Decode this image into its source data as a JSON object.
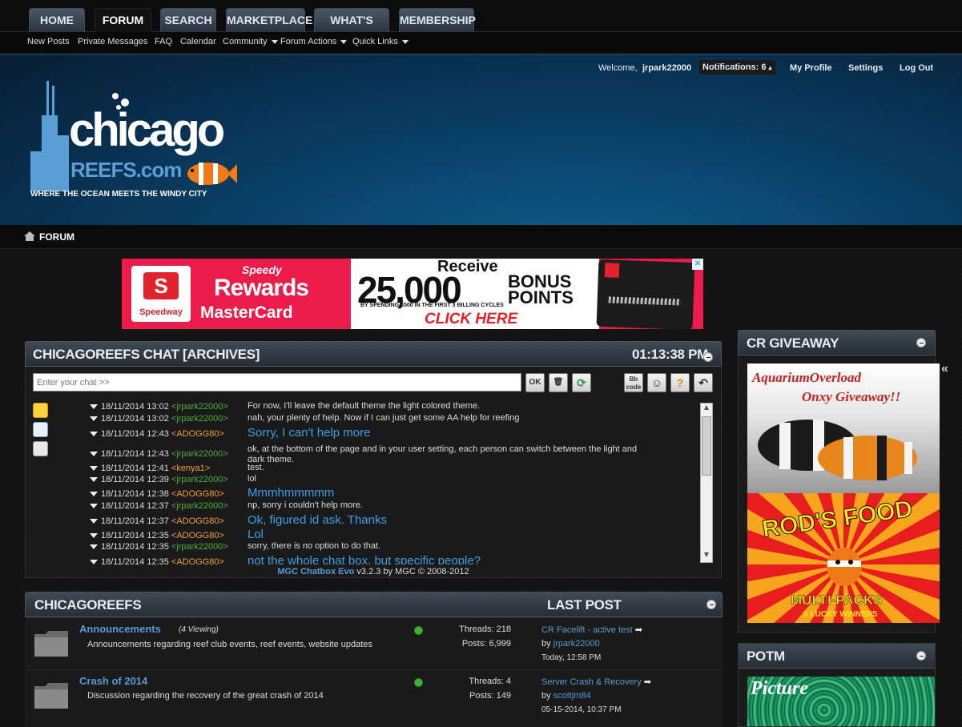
{
  "nav": {
    "tabs": [
      {
        "label": "HOME"
      },
      {
        "label": "FORUM"
      },
      {
        "label": "SEARCH"
      },
      {
        "label": "MARKETPLACE"
      },
      {
        "label": "WHAT'S NEW?"
      },
      {
        "label": "MEMBERSHIP"
      }
    ],
    "sublinks": [
      "New Posts",
      "Private Messages",
      "FAQ",
      "Calendar",
      "Community",
      "Forum Actions",
      "Quick Links"
    ]
  },
  "user": {
    "welcome": "Welcome,",
    "username": "jrpark22000",
    "notifications": "Notifications: 6",
    "profile": "My Profile",
    "settings": "Settings",
    "logout": "Log Out"
  },
  "logo": {
    "line1": "chicago",
    "line2": "REEFS.com",
    "tagline": "WHERE THE OCEAN MEETS THE WINDY CITY"
  },
  "breadcrumb": {
    "label": "FORUM"
  },
  "ad": {
    "brand": "Speedway",
    "card1": "Speedy",
    "card2": "Rewards",
    "card3": "MasterCard",
    "receive": "Receive",
    "amount": "25,000",
    "bonus": "BONUS",
    "points": "POINTS",
    "fine": "BY SPENDING $500 IN THE FIRST 3 BILLING CYCLES",
    "cta": "CLICK HERE"
  },
  "chat": {
    "title": "CHICAGOREEFS CHAT [ARCHIVES]",
    "time": "01:13:38 PM",
    "placeholder": "Enter your chat >>",
    "ok": "OK",
    "bb": "Bb code",
    "footer_link": "MGC Chatbox Evo",
    "footer_rest": " v3.2.3 by MGC © 2008-2012",
    "messages": [
      {
        "ts": "18/11/2014 13:02",
        "user": "jrpark22000",
        "color": "g",
        "text": "For now, I'll leave the default theme the light colored theme.",
        "big": false
      },
      {
        "ts": "18/11/2014 13:02",
        "user": "jrpark22000",
        "color": "g",
        "text": "nah, your plenty of help. Now if I can just get some AA help for reefing",
        "big": false
      },
      {
        "ts": "18/11/2014 12:43",
        "user": "ADOGG80",
        "color": "o",
        "text": "Sorry, I can't help more",
        "big": true
      },
      {
        "ts": "18/11/2014 12:43",
        "user": "jrpark22000",
        "color": "g",
        "text": "ok, at the bottom of the page and in your user setting, each person can switch between the light and",
        "text2": "dark theme.",
        "big": false
      },
      {
        "ts": "18/11/2014 12:41",
        "user": "kenya1",
        "color": "o",
        "text": "test.",
        "big": false
      },
      {
        "ts": "18/11/2014 12:39",
        "user": "jrpark22000",
        "color": "g",
        "text": "lol",
        "big": false
      },
      {
        "ts": "18/11/2014 12:38",
        "user": "ADOGG80",
        "color": "o",
        "text": "Mmmhmmmmm",
        "big": true
      },
      {
        "ts": "18/11/2014 12:37",
        "user": "jrpark22000",
        "color": "g",
        "text": "np, sorry i couldn't help more.",
        "big": false
      },
      {
        "ts": "18/11/2014 12:37",
        "user": "ADOGG80",
        "color": "o",
        "text": "Ok, figured id ask. Thanks",
        "big": true
      },
      {
        "ts": "18/11/2014 12:35",
        "user": "ADOGG80",
        "color": "o",
        "text": "Lol",
        "big": true
      },
      {
        "ts": "18/11/2014 12:35",
        "user": "jrpark22000",
        "color": "g",
        "text": "sorry, there is no option to do that.",
        "big": false
      },
      {
        "ts": "18/11/2014 12:35",
        "user": "ADOGG80",
        "color": "o",
        "text": "not the whole chat box, but specific people?",
        "big": true
      }
    ]
  },
  "forum": {
    "title": "CHICAGOREEFS",
    "lastpost_header": "LAST POST",
    "rows": [
      {
        "title": "Announcements",
        "viewing": "(4 Viewing)",
        "desc": "Announcements regarding reef club events, reef events, website updates",
        "threads": "Threads: 218",
        "posts": "Posts: 6,999",
        "lp_title": "CR Facelift - active test",
        "lp_by": "by",
        "lp_user": "jrpark22000",
        "lp_date": "Today,",
        "lp_time": "12:58 PM"
      },
      {
        "title": "Crash of 2014",
        "viewing": "",
        "desc": "Discussion regarding the recovery of the great crash of 2014",
        "threads": "Threads: 4",
        "posts": "Posts: 149",
        "lp_title": "Server Crash & Recovery",
        "lp_by": "by",
        "lp_user": "scottjm84",
        "lp_date": "05-15-2014,",
        "lp_time": "10:37 PM"
      }
    ]
  },
  "sidebar": {
    "giveaway_title": "CR GIVEAWAY",
    "giveaway_line1": "AquariumOverload",
    "giveaway_line2": "Onxy Giveaway!!",
    "rods_title": "ROD'S FOOD",
    "rods_sub": "MULTI-PACKS",
    "rods_sub2": "5 LUCKY WINNERS",
    "potm_title": "POTM",
    "potm_text": "Picture"
  }
}
